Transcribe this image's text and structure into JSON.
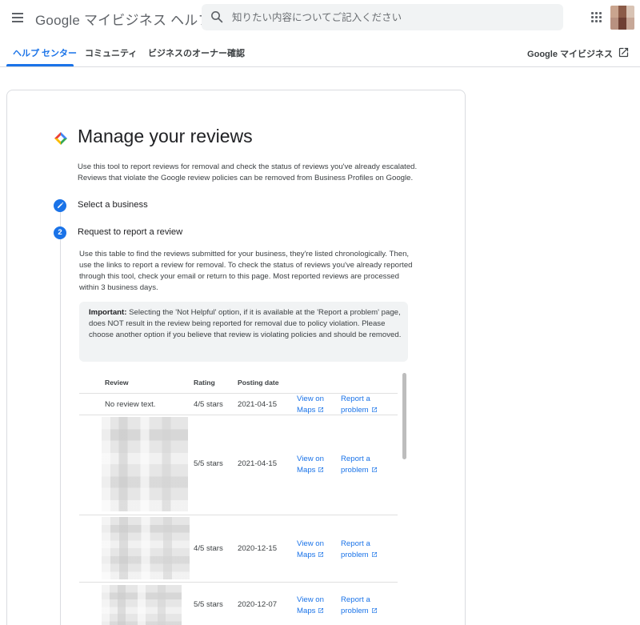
{
  "header": {
    "app_title": "Google マイビジネス ヘルプ",
    "search_placeholder": "知りたい内容についてご記入ください"
  },
  "tabs": [
    {
      "label": "ヘルプ センター",
      "active": true
    },
    {
      "label": "コミュニティ",
      "active": false
    },
    {
      "label": "ビジネスのオーナー確認",
      "active": false
    }
  ],
  "external_link": {
    "label": "Google マイビジネス"
  },
  "page": {
    "title": "Manage your reviews",
    "intro": "Use this tool to report reviews for removal and check the status of reviews you've already escalated. Reviews that violate the Google review policies can be removed from Business Profiles on Google.",
    "steps": [
      {
        "marker": "pencil",
        "label": "Select a business"
      },
      {
        "marker": "2",
        "label": "Request to report a review"
      }
    ],
    "description": "Use this table to find the reviews submitted for your business, they're listed chronologically. Then, use the links to report a review for removal. To check the status of reviews you've already reported through this tool, check your email or return to this page. Most reported reviews are processed within 3 business days.",
    "notice": {
      "bold": "Important:",
      "text": " Selecting the 'Not Helpful' option, if it is available at the 'Report a problem' page, does NOT result in the review being reported for removal due to policy violation. Please choose another option if you believe that review is violating policies and should be removed."
    }
  },
  "table": {
    "headers": {
      "review": "Review",
      "rating": "Rating",
      "date": "Posting date"
    },
    "rows": [
      {
        "review": "No review text.",
        "rating": "4/5 stars",
        "date": "2021-04-15",
        "maps_link": "View on Maps",
        "report_link": "Report a problem"
      },
      {
        "review": "",
        "rating": "5/5 stars",
        "date": "2021-04-15",
        "maps_link": "View on Maps",
        "report_link": "Report a problem"
      },
      {
        "review": "",
        "rating": "4/5 stars",
        "date": "2020-12-15",
        "maps_link": "View on Maps",
        "report_link": "Report a problem"
      },
      {
        "review": "",
        "rating": "5/5 stars",
        "date": "2020-12-07",
        "maps_link": "View on Maps",
        "report_link": "Report a problem"
      }
    ]
  },
  "colors": {
    "accent": "#1a73e8",
    "text": "#202124",
    "notice_bg": "#f1f3f4"
  }
}
